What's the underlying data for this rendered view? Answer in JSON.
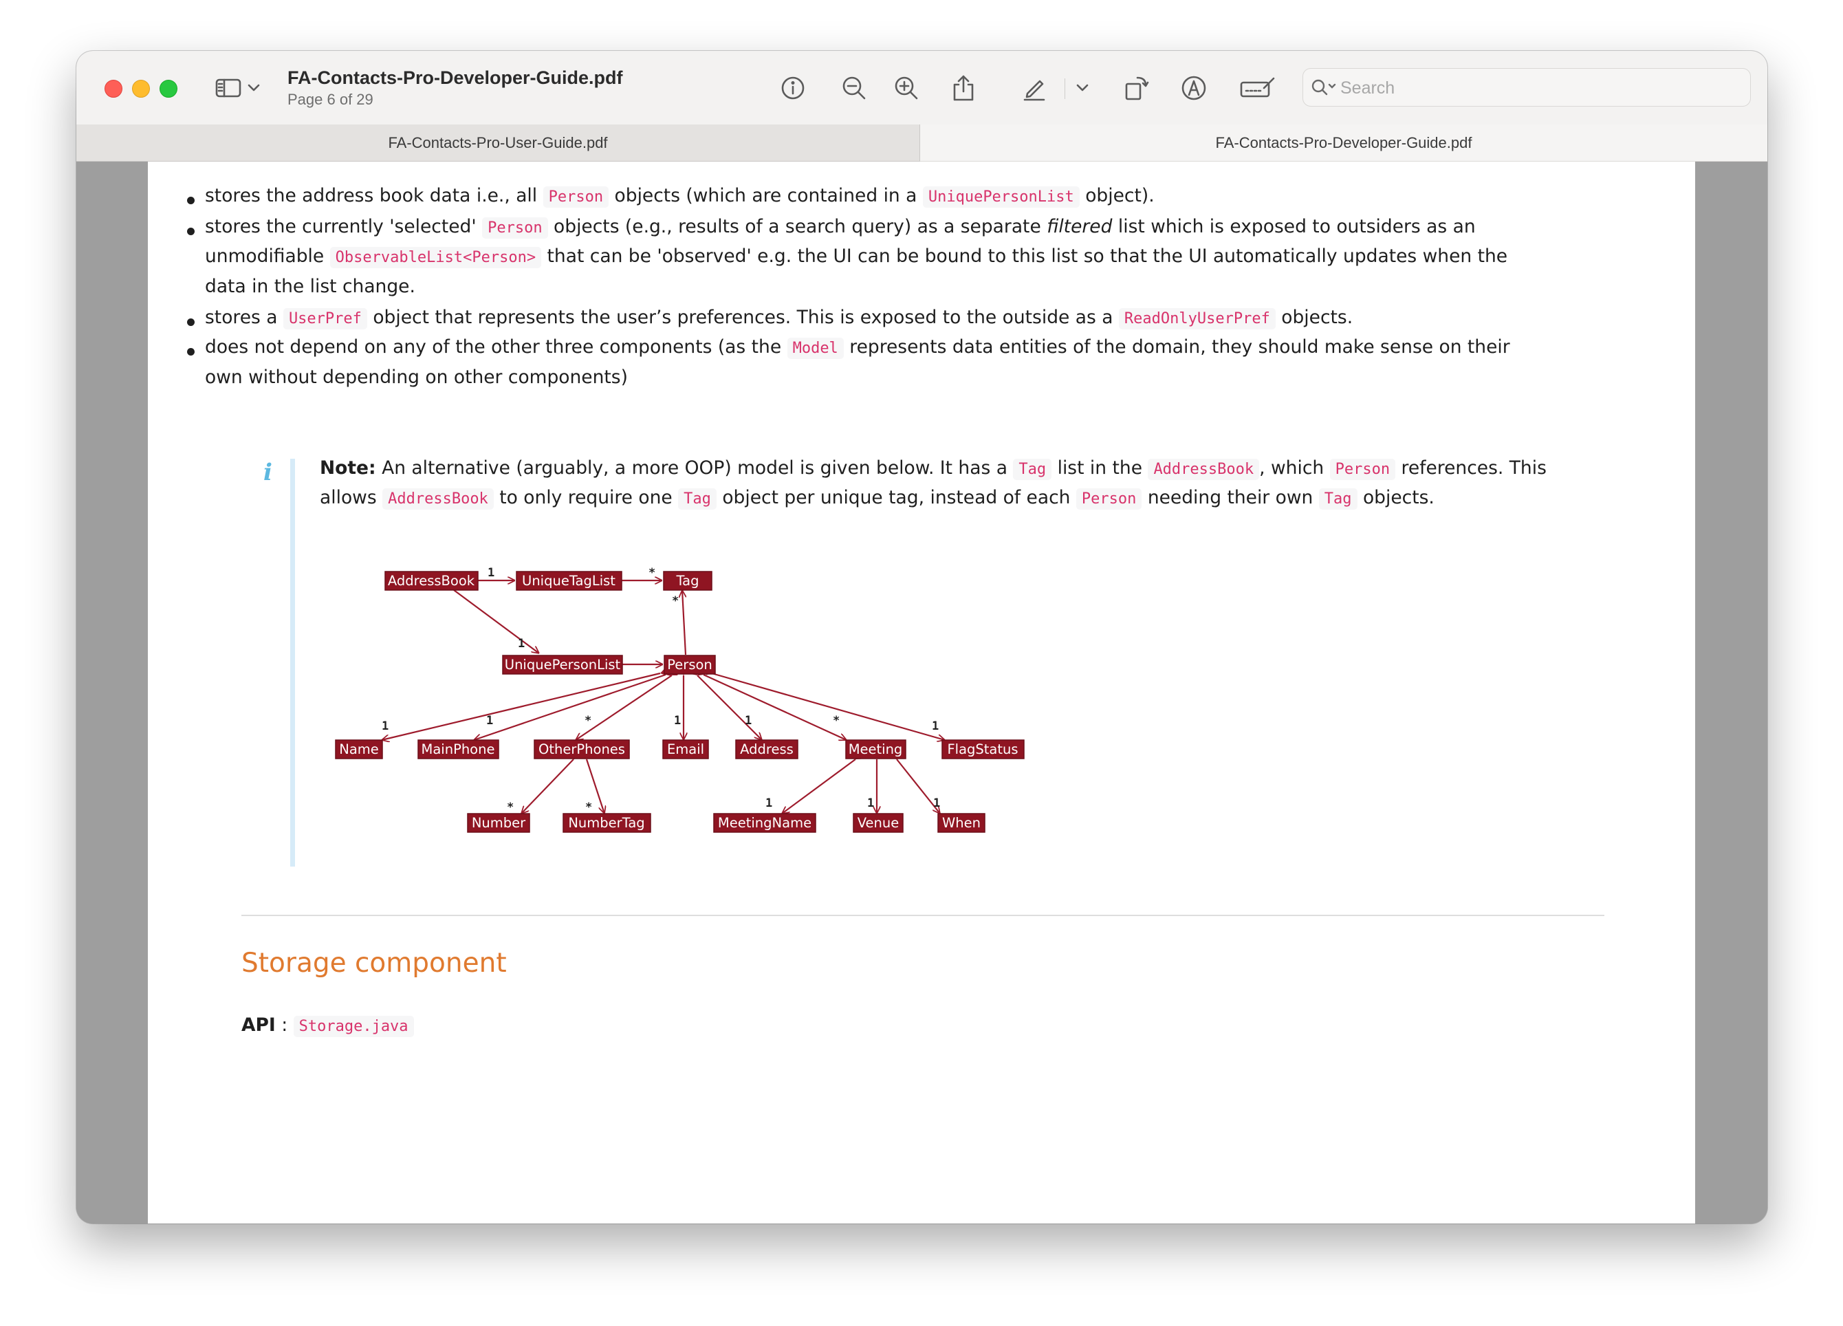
{
  "window": {
    "title": "FA-Contacts-Pro-Developer-Guide.pdf",
    "subtitle": "Page 6 of 29",
    "search_placeholder": "Search",
    "toolbar_icons": [
      "sidebar-icon",
      "chevron-down-icon",
      "info-icon",
      "zoom-out-icon",
      "zoom-in-icon",
      "share-icon",
      "highlight-pen-icon",
      "chevron-down-icon",
      "rotate-icon",
      "markup-icon",
      "signature-icon",
      "search-icon"
    ]
  },
  "tabs": [
    {
      "label": "FA-Contacts-Pro-User-Guide.pdf",
      "active": false
    },
    {
      "label": "FA-Contacts-Pro-Developer-Guide.pdf",
      "active": true
    }
  ],
  "bullets": {
    "b1": {
      "t1": "stores the address book data i.e., all",
      "c1": "Person",
      "t2": "objects (which are contained in a",
      "c2": "UniquePersonList",
      "t3": "object)."
    },
    "b2": {
      "t1": "stores the currently 'selected'",
      "c1": "Person",
      "t2": "objects (e.g., results of a search query) as a separate",
      "em": "filtered",
      "t3": "list which is exposed to outsiders as an",
      "l2a": "unmodifiable",
      "c2": "ObservableList<Person>",
      "l2b": "that can be 'observed' e.g. the UI can be bound to this list so that the UI automatically updates when the",
      "l3": "data in the list change."
    },
    "b3": {
      "t1": "stores a",
      "c1": "UserPref",
      "t2": "object that represents the user’s preferences. This is exposed to the outside as a",
      "c2": "ReadOnlyUserPref",
      "t3": "objects."
    },
    "b4": {
      "t1": "does not depend on any of the other three components (as the",
      "c1": "Model",
      "t2": "represents data entities of the domain, they should make sense on their",
      "l2": "own without depending on other components)"
    }
  },
  "note": {
    "icon": "i",
    "label": "Note:",
    "t1": "An alternative (arguably, a more OOP) model is given below. It has a",
    "c1": "Tag",
    "t2": "list in the",
    "c2": "AddressBook",
    "t3": ", which",
    "c3": "Person",
    "t4": "references. This",
    "l2a": "allows",
    "c4": "AddressBook",
    "l2b": "to only require one",
    "c5": "Tag",
    "l2c": "object per unique tag, instead of each",
    "c6": "Person",
    "l2d": "needing their own",
    "c7": "Tag",
    "l2e": "objects."
  },
  "diagram": {
    "node_color": "#8f1522",
    "edge_color": "#9e1b2c",
    "nodes": {
      "addressbook": "AddressBook",
      "uniquetaglist": "UniqueTagList",
      "tag": "Tag",
      "uniquepersonlist": "UniquePersonList",
      "person": "Person",
      "name": "Name",
      "mainphone": "MainPhone",
      "otherphones": "OtherPhones",
      "email": "Email",
      "address": "Address",
      "meeting": "Meeting",
      "flagstatus": "FlagStatus",
      "number": "Number",
      "numbertag": "NumberTag",
      "meetingname": "MeetingName",
      "venue": "Venue",
      "when": "When"
    },
    "multiplicities": {
      "addressbook_uniquetaglist": "1",
      "uniquetaglist_tag": "*",
      "person_tag": "*",
      "addressbook_uniquepersonlist": "1",
      "person_name": "1",
      "person_mainphone": "1",
      "person_otherphones": "*",
      "person_email": "1",
      "person_address": "1",
      "person_meeting": "*",
      "person_flagstatus": "1",
      "otherphones_number": "*",
      "otherphones_numbertag": "*",
      "meeting_meetingname": "1",
      "meeting_venue": "1",
      "meeting_when": "1"
    }
  },
  "storage": {
    "heading": "Storage component",
    "heading_color": "#e07a2f",
    "api_label": "API",
    "api_sep": ":",
    "api_code": "Storage.java"
  }
}
